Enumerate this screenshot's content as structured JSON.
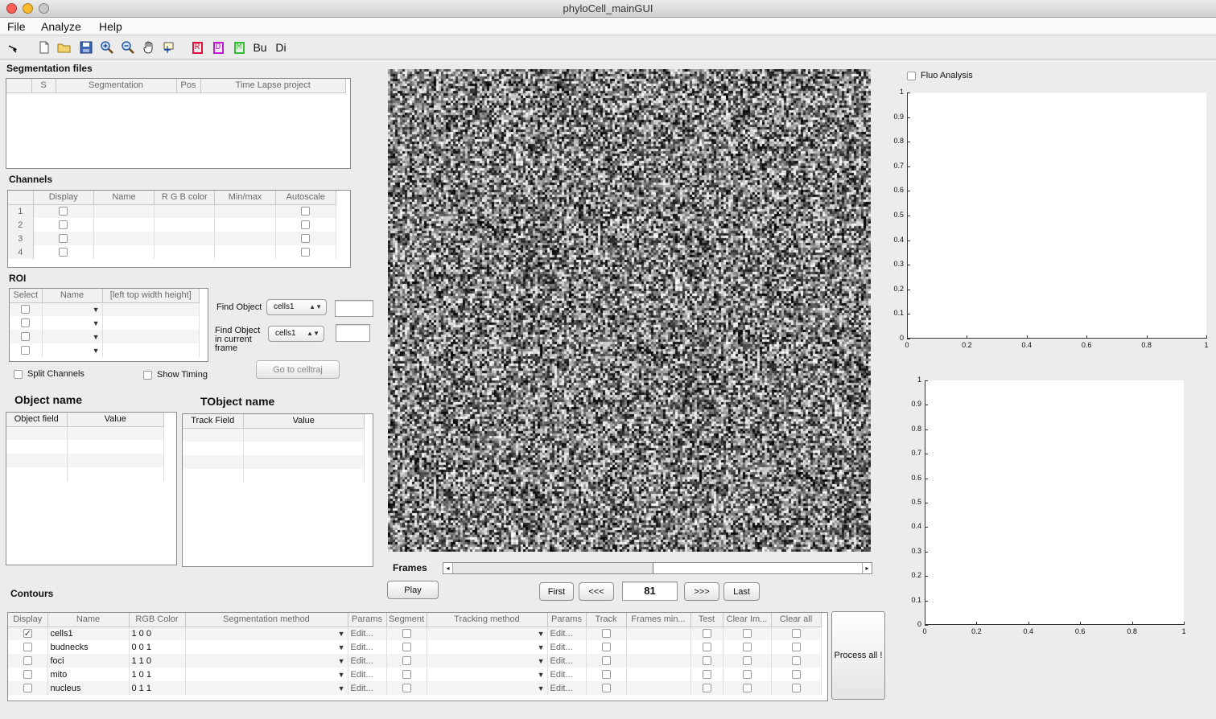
{
  "window": {
    "title": "phyloCell_mainGUI"
  },
  "menu": [
    "File",
    "Analyze",
    "Help"
  ],
  "toolbar": {
    "icons": [
      "arrow-icon",
      "new-file-icon",
      "open-folder-icon",
      "save-icon",
      "zoom-in-icon",
      "zoom-out-icon",
      "pan-hand-icon",
      "data-cursor-icon",
      "r-icon",
      "d-icon",
      "m-icon",
      "bu-icon",
      "di-icon"
    ],
    "letters": {
      "r": "R",
      "d": "D",
      "m": "M",
      "bu": "Bu",
      "di": "Di"
    }
  },
  "segmentation": {
    "label": "Segmentation files",
    "headers": [
      "",
      "S",
      "Segmentation",
      "Pos",
      "Time Lapse project"
    ]
  },
  "channels": {
    "label": "Channels",
    "headers": [
      "",
      "Display",
      "Name",
      "R G B color",
      "Min/max",
      "Autoscale"
    ],
    "rows": [
      "1",
      "2",
      "3",
      "4"
    ]
  },
  "roi": {
    "label": "ROI",
    "headers": [
      "Select",
      "Name",
      "[left top width height]"
    ],
    "rows": 4
  },
  "options": {
    "split_channels": "Split Channels",
    "show_timing": "Show Timing"
  },
  "find": {
    "find_object_label": "Find Object",
    "find_object_value": "cells1",
    "find_current_label_1": "Find Object",
    "find_current_label_2": "in current",
    "find_current_label_3": "frame",
    "find_current_value": "cells1",
    "go_button": "Go to celltraj"
  },
  "object": {
    "title": "Object name",
    "headers": [
      "Object field",
      "Value"
    ]
  },
  "tobject": {
    "title": "TObject name",
    "headers": [
      "Track Field",
      "Value"
    ]
  },
  "frames": {
    "label": "Frames",
    "play": "Play",
    "first": "First",
    "prev": "<<<",
    "current": "81",
    "next": ">>>",
    "last": "Last",
    "slider_fraction": 0.49
  },
  "fluo": {
    "label": "Fluo Analysis"
  },
  "plot_top": {
    "yticks": [
      "1",
      "0.9",
      "0.8",
      "0.7",
      "0.6",
      "0.5",
      "0.4",
      "0.3",
      "0.2",
      "0.1",
      "0"
    ],
    "xticks": [
      "0",
      "0.2",
      "0.4",
      "0.6",
      "0.8",
      "1"
    ]
  },
  "plot_bottom": {
    "yticks": [
      "1",
      "0.9",
      "0.8",
      "0.7",
      "0.6",
      "0.5",
      "0.4",
      "0.3",
      "0.2",
      "0.1",
      "0"
    ],
    "xticks": [
      "0",
      "0.2",
      "0.4",
      "0.6",
      "0.8",
      "1"
    ]
  },
  "contours": {
    "label": "Contours",
    "headers": [
      "Display",
      "Name",
      "RGB Color",
      "Segmentation method",
      "Params",
      "Segment",
      "Tracking method",
      "Params",
      "Track",
      "Frames min...",
      "Test",
      "Clear Im...",
      "Clear all"
    ],
    "rows": [
      {
        "display": true,
        "name": "cells1",
        "rgb": "1  0  0",
        "params": "Edit...",
        "params2": "Edit..."
      },
      {
        "display": false,
        "name": "budnecks",
        "rgb": "0  0  1",
        "params": "Edit...",
        "params2": "Edit..."
      },
      {
        "display": false,
        "name": "foci",
        "rgb": "1  1  0",
        "params": "Edit...",
        "params2": "Edit..."
      },
      {
        "display": false,
        "name": "mito",
        "rgb": "1  0  1",
        "params": "Edit...",
        "params2": "Edit..."
      },
      {
        "display": false,
        "name": "nucleus",
        "rgb": "0  1  1",
        "params": "Edit...",
        "params2": "Edit..."
      }
    ],
    "process_all": "Process all !"
  },
  "colors": {
    "r_icon": "#e0123f",
    "d_icon": "#c31bd1",
    "m_icon": "#2fbf2f"
  }
}
